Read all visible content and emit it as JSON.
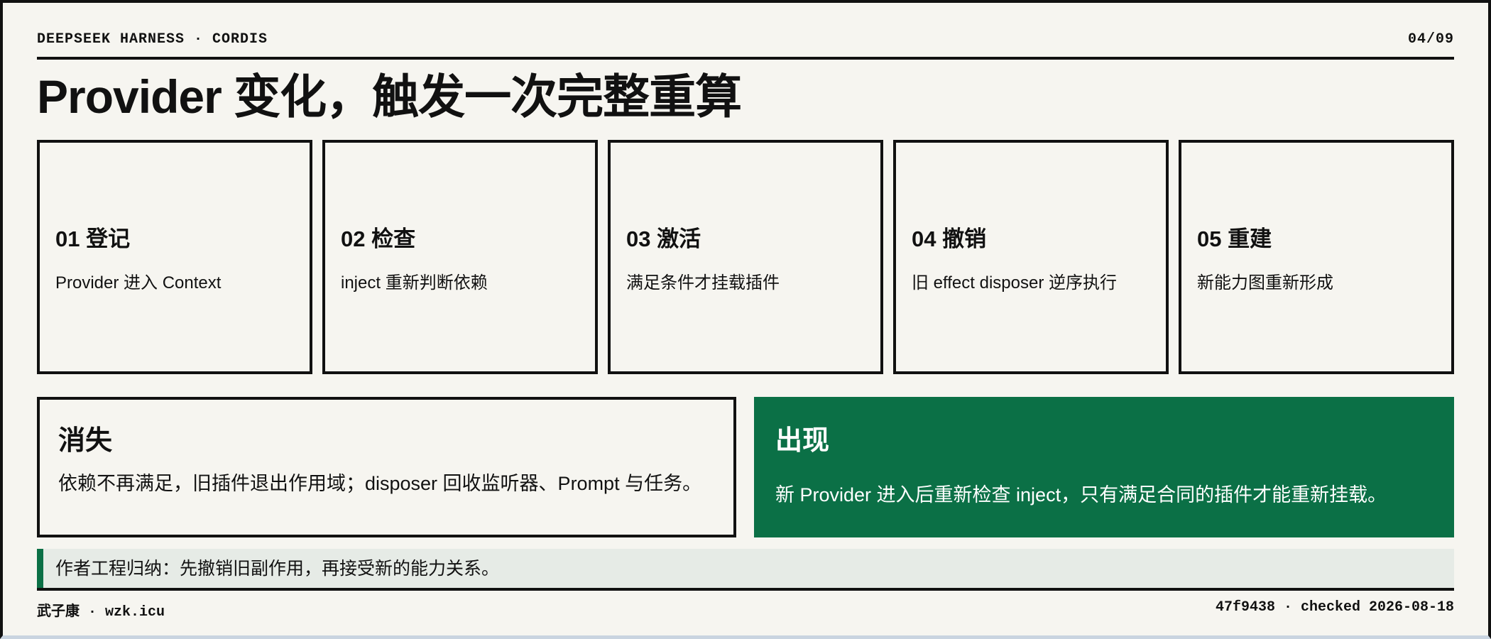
{
  "header": {
    "brand": "DEEPSEEK HARNESS · CORDIS",
    "page": "04/09"
  },
  "title": "Provider 变化，触发一次完整重算",
  "steps": [
    {
      "label": "01 登记",
      "desc": "Provider 进入 Context"
    },
    {
      "label": "02 检查",
      "desc": "inject 重新判断依赖"
    },
    {
      "label": "03 激活",
      "desc": "满足条件才挂载插件"
    },
    {
      "label": "04 撤销",
      "desc": "旧 effect disposer 逆序执行"
    },
    {
      "label": "05 重建",
      "desc": "新能力图重新形成"
    }
  ],
  "gone": {
    "heading": "消失",
    "text": "依赖不再满足，旧插件退出作用域；disposer 回收监听器、Prompt 与任务。"
  },
  "appear": {
    "heading": "出现",
    "text": "新 Provider 进入后重新检查 inject，只有满足合同的插件才能重新挂载。"
  },
  "note": "作者工程归纳：先撤销旧副作用，再接受新的能力关系。",
  "footer": {
    "author": "武子康 · wzk.icu",
    "meta": "47f9438 · checked 2026-08-18"
  },
  "colors": {
    "accent_green": "#0b7046",
    "background": "#f6f5f0",
    "note_background": "#e6ebe6"
  }
}
